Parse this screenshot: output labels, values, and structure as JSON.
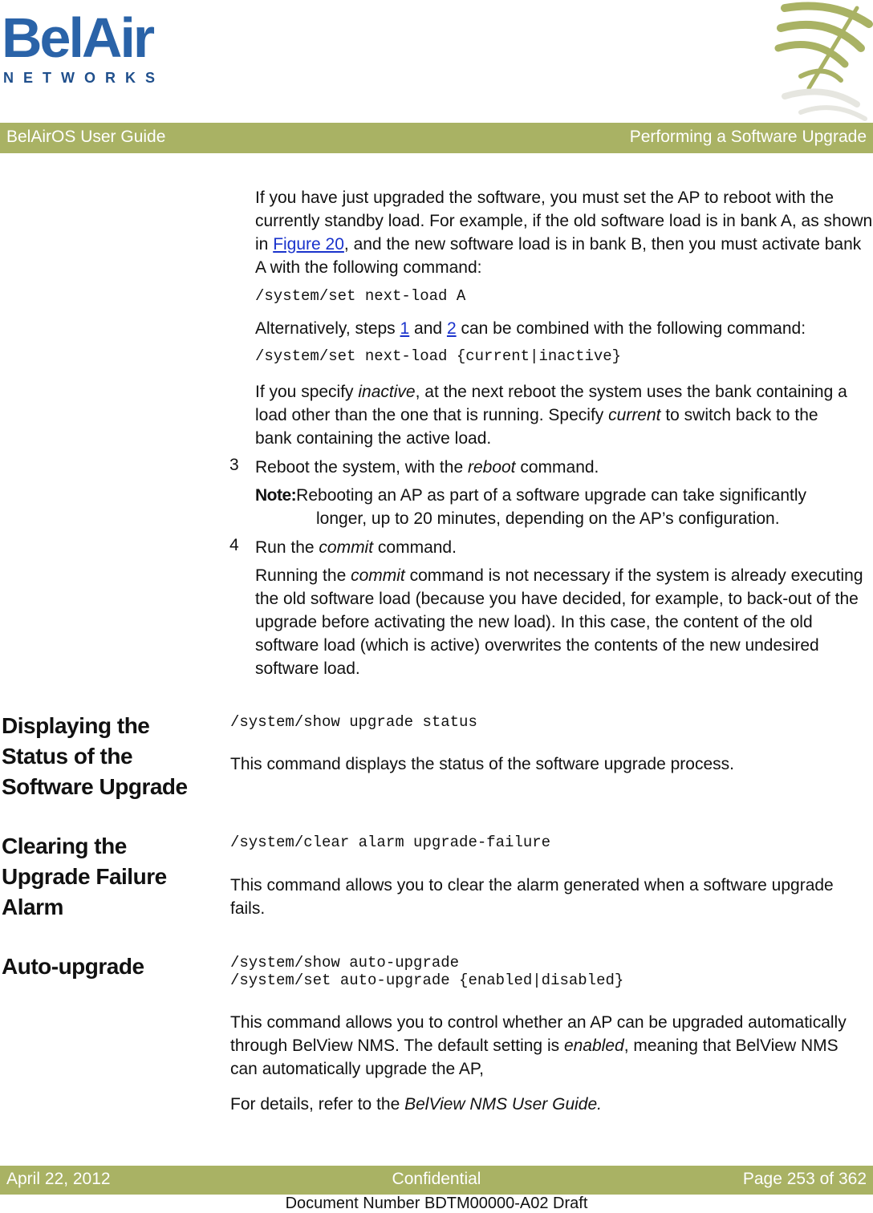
{
  "logo": {
    "main": "BelAir",
    "sub": "NETWORKS"
  },
  "header": {
    "left": "BelAirOS User Guide",
    "right": "Performing a Software Upgrade"
  },
  "content": {
    "p1": {
      "t1": "If you have just upgraded the software, you must set the AP to reboot with the currently standby load. For example, if the old software load is in bank A, as shown in ",
      "link": "Figure 20",
      "t2": ", and the new software load is in bank B, then you must activate bank A with the following command:"
    },
    "code1": "/system/set next-load A",
    "p2": {
      "t1": "Alternatively, steps ",
      "link1": "1",
      "t2": " and ",
      "link2": "2",
      "t3": " can be combined with the following command:"
    },
    "code2": "/system/set next-load {current|inactive}",
    "p3": {
      "t1": "If you specify ",
      "em1": "inactive",
      "t2": ", at the next reboot the system uses the bank containing a load other than the one that is running. Specify ",
      "em2": "current",
      "t3": " to switch back to the bank containing the active load."
    },
    "step3": {
      "num": "3",
      "t1": "Reboot the system, with the ",
      "em": "reboot",
      "t2": " command."
    },
    "note": {
      "label": "Note:",
      "line1": "Rebooting an AP as part of a software upgrade can take significantly",
      "line2": "longer, up to 20 minutes, depending on the AP’s configuration."
    },
    "step4": {
      "num": "4",
      "t1": "Run the ",
      "em": "commit",
      "t2": " command."
    },
    "p4": {
      "t1": "Running the ",
      "em": "commit",
      "t2": " command is not necessary if the system is already executing the old software load (because you have decided, for example, to back-out of the upgrade before activating the new load). In this case, the content of the old software load (which is active) overwrites the contents of the new undesired software load."
    }
  },
  "sections": [
    {
      "title": "Displaying the Status of the Software Upgrade",
      "code": "/system/show upgrade status",
      "text": "This command displays the status of the software upgrade process."
    },
    {
      "title": "Clearing the Upgrade Failure Alarm",
      "code": "/system/clear alarm upgrade-failure",
      "text": "This command allows you to clear the alarm generated when a software upgrade fails."
    },
    {
      "title": "Auto-upgrade",
      "code": "/system/show auto-upgrade\n/system/set auto-upgrade {enabled|disabled}",
      "text1": "This command allows you to control whether an AP can be upgraded automatically through BelView NMS. The default setting is ",
      "em": "enabled",
      "text2": ", meaning that BelView NMS can automatically upgrade the AP,",
      "ref_t1": "For details, refer to the ",
      "ref_em": "BelView NMS User Guide."
    }
  ],
  "footer": {
    "date": "April 22, 2012",
    "center": "Confidential",
    "page": "Page 253 of 362",
    "doc_number": "Document Number BDTM00000-A02 Draft"
  },
  "colors": {
    "bar": "#a9b264",
    "logo": "#2a63a8",
    "link": "#1a33cc"
  }
}
